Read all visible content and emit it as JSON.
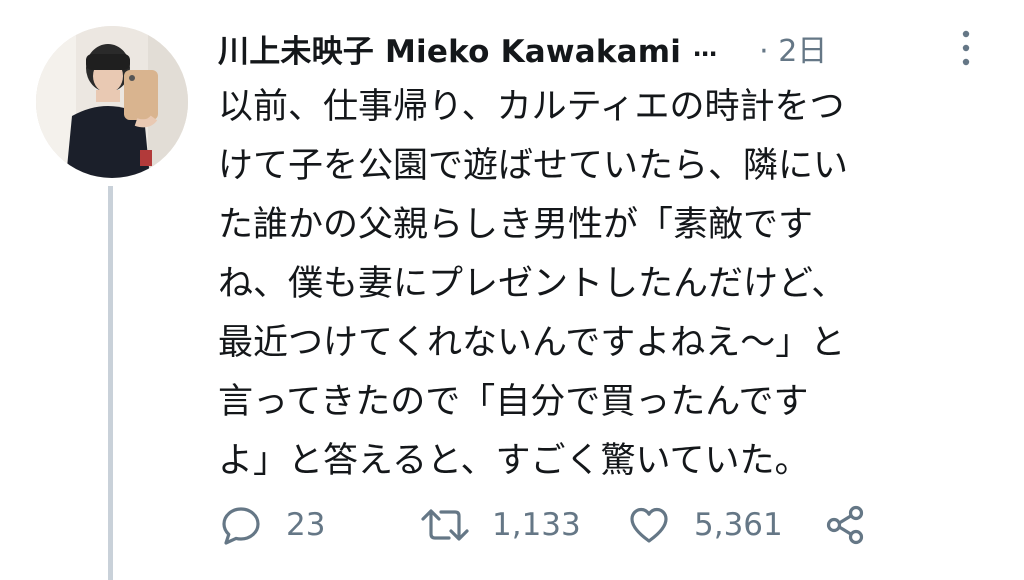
{
  "tweet": {
    "display_name": "川上未映子 Mieko Kawakami",
    "truncation": "…",
    "timestamp": "· 2日",
    "text": "以前、仕事帰り、カルティエの時計をつ\nけて子を公園で遊ばせていたら、隣にい\nた誰かの父親らしき男性が「素敵です\nね、僕も妻にプレゼントしたんだけど、\n最近つけてくれないんですよねえ〜」と\n言ってきたので「自分で買ったんです\nよ」と答えると、すごく驚いていた。"
  },
  "actions": {
    "replies": "23",
    "retweets": "1,133",
    "likes": "5,361"
  },
  "icons": {
    "reply": "reply-bubble-icon",
    "retweet": "retweet-arrows-icon",
    "like": "heart-icon",
    "share": "share-icon",
    "more": "vertical-more-icon"
  },
  "colors": {
    "text": "#14171a",
    "secondary": "#657786",
    "thread_line": "#c9d1d9"
  }
}
